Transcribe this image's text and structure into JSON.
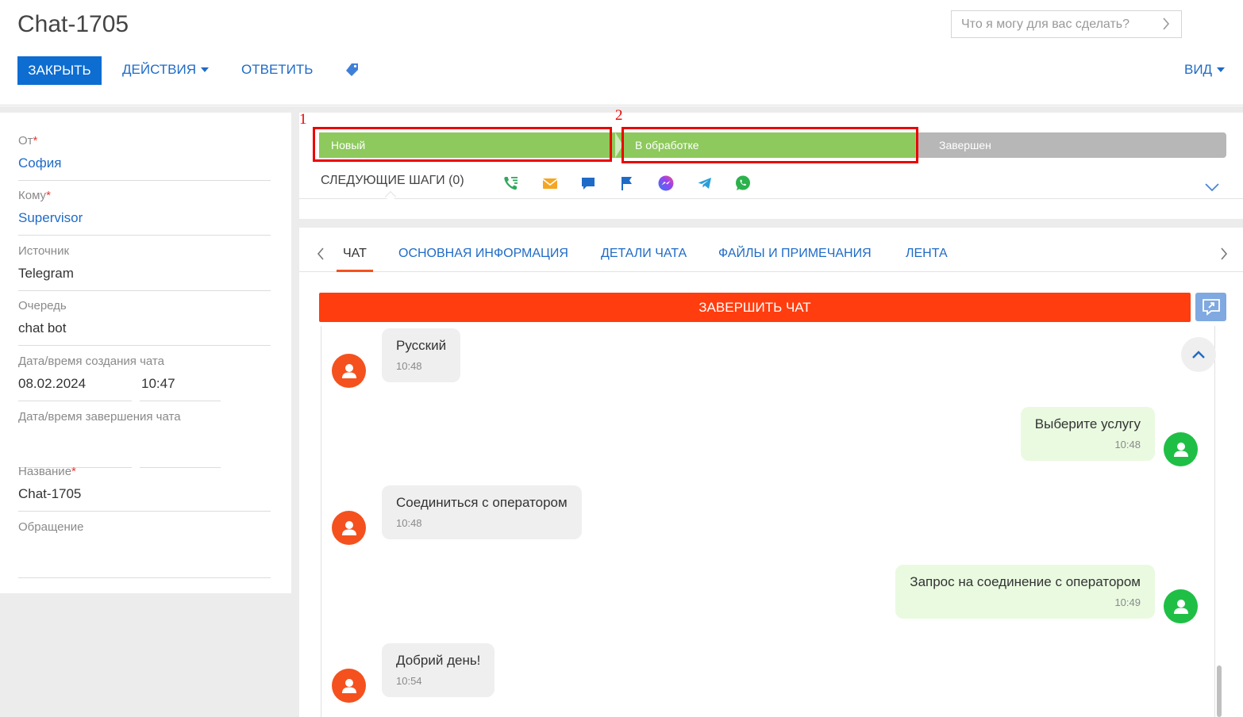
{
  "header": {
    "title": "Chat-1705",
    "command_placeholder": "Что я могу для вас сделать?",
    "close_label": "ЗАКРЫТЬ",
    "actions_label": "ДЕЙСТВИЯ",
    "reply_label": "ОТВЕТИТЬ",
    "view_label": "ВИД"
  },
  "fields": {
    "from": {
      "label": "От",
      "value": "София"
    },
    "to": {
      "label": "Кому",
      "value": "Supervisor"
    },
    "source": {
      "label": "Источник",
      "value": "Telegram"
    },
    "queue": {
      "label": "Очередь",
      "value": "chat bot"
    },
    "created": {
      "label": "Дата/время создания чата",
      "date": "08.02.2024",
      "time": "10:47"
    },
    "finished": {
      "label": "Дата/время завершения чата",
      "date": "",
      "time": ""
    },
    "name": {
      "label": "Название",
      "value": "Chat-1705"
    },
    "appeal": {
      "label": "Обращение",
      "value": ""
    },
    "required_mark": "*"
  },
  "stages": [
    {
      "label": "Новый",
      "status": "completed",
      "color": "#8dc95c"
    },
    {
      "label": "В обработке",
      "status": "current",
      "color": "#8dc95c"
    },
    {
      "label": "Завершен",
      "status": "pending",
      "color": "#b7b7b7"
    }
  ],
  "annotations": [
    {
      "number": "1"
    },
    {
      "number": "2"
    }
  ],
  "next_steps": {
    "label": "СЛЕДУЮЩИЕ ШАГИ (0)",
    "icons": [
      "call-icon",
      "email-icon",
      "chat-bubble-icon",
      "flag-icon",
      "messenger-icon",
      "telegram-icon",
      "whatsapp-icon"
    ]
  },
  "tabs": [
    {
      "label": "ЧАТ",
      "active": true
    },
    {
      "label": "ОСНОВНАЯ ИНФОРМАЦИЯ",
      "active": false
    },
    {
      "label": "ДЕТАЛИ ЧАТА",
      "active": false
    },
    {
      "label": "ФАЙЛЫ И ПРИМЕЧАНИЯ",
      "active": false
    },
    {
      "label": "ЛЕНТА",
      "active": false
    }
  ],
  "chat": {
    "end_chat_label": "ЗАВЕРШИТЬ ЧАТ",
    "messages": [
      {
        "direction": "in",
        "text": "Русский",
        "time": "10:48"
      },
      {
        "direction": "out",
        "text": "Выберите услугу",
        "time": "10:48"
      },
      {
        "direction": "in",
        "text": "Соединиться с оператором",
        "time": "10:48"
      },
      {
        "direction": "out",
        "text": "Запрос на соединение с оператором",
        "time": "10:49"
      },
      {
        "direction": "in",
        "text": "Добрий день!",
        "time": "10:54"
      }
    ]
  },
  "colors": {
    "primary": "#0d6dd1",
    "link": "#1f6bc7",
    "end_chat": "#ff3d0f",
    "stage_active": "#8dc95c",
    "stage_pending": "#b7b7b7",
    "annotation": "#ec0000"
  }
}
